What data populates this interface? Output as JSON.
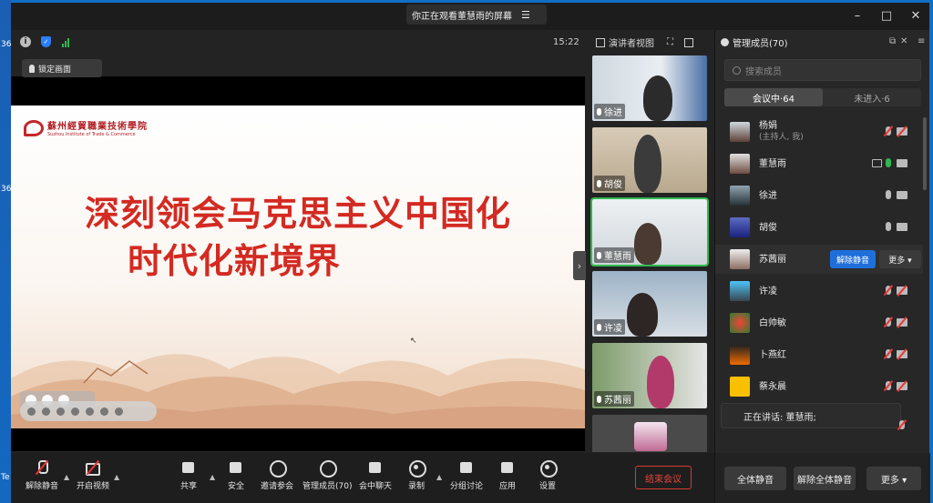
{
  "desktop": {
    "labels": [
      "36",
      "36",
      "Te"
    ]
  },
  "window": {
    "share_banner": "你正在观看董慧雨的屏幕",
    "share_menu_icon": "menu-icon"
  },
  "meeting_bar": {
    "time": "15:22",
    "view_label": "演讲者视图",
    "icons": [
      "info-icon",
      "shield-icon",
      "signal-icon"
    ]
  },
  "lock_button": "锁定画面",
  "slide": {
    "school_cn": "蘇州經貿職業技術學院",
    "school_en": "Suzhou Institute of Trade & Commerce",
    "title_line1": "深刻领会马克思主义中国化",
    "title_line2": "时代化新境界"
  },
  "gallery": [
    {
      "name": "徐进",
      "active": false
    },
    {
      "name": "胡俊",
      "active": false
    },
    {
      "name": "董慧雨",
      "active": true
    },
    {
      "name": "许凌",
      "active": false
    },
    {
      "name": "苏茜丽",
      "active": false
    }
  ],
  "toolbar": {
    "unmute": "解除静音",
    "start_video": "开启视频",
    "share": "共享",
    "security": "安全",
    "invite": "邀请参会",
    "manage_members": "管理成员(70)",
    "chat": "会中聊天",
    "record": "录制",
    "breakout": "分组讨论",
    "apps": "应用",
    "settings": "设置",
    "end_meeting": "结束会议"
  },
  "panel": {
    "title": "管理成员(70)",
    "search_placeholder": "搜索成员",
    "tab_in": "会议中·64",
    "tab_out": "未进入·6",
    "members": [
      {
        "name": "杨娟",
        "sub": "(主持人, 我)",
        "mic": "muted",
        "cam": "muted",
        "share": false
      },
      {
        "name": "董慧雨",
        "sub": "",
        "mic": "live",
        "cam": "on",
        "share": true
      },
      {
        "name": "徐进",
        "sub": "",
        "mic": "on",
        "cam": "on",
        "share": false
      },
      {
        "name": "胡俊",
        "sub": "",
        "mic": "on",
        "cam": "on",
        "share": false
      },
      {
        "name": "苏茜丽",
        "sub": "",
        "mic": "hidden",
        "cam": "hidden",
        "share": false
      },
      {
        "name": "许凌",
        "sub": "",
        "mic": "muted",
        "cam": "muted",
        "share": false
      },
      {
        "name": "白帅敏",
        "sub": "",
        "mic": "muted",
        "cam": "muted",
        "share": false
      },
      {
        "name": "卜燕红",
        "sub": "",
        "mic": "muted",
        "cam": "muted",
        "share": false
      },
      {
        "name": "蔡永晨",
        "sub": "",
        "mic": "muted",
        "cam": "muted",
        "share": false
      }
    ],
    "unmute_button": "解除静音",
    "more_button": "更多 ▾",
    "speaking": "正在讲话: 董慧雨;",
    "mute_all": "全体静音",
    "unmute_all": "解除全体静音",
    "footer_more": "更多 ▾"
  },
  "colors": {
    "accent_blue": "#1f6fdb",
    "live_green": "#2fb84f",
    "danger_red": "#e8453c",
    "slide_title_red": "#d32a22"
  }
}
